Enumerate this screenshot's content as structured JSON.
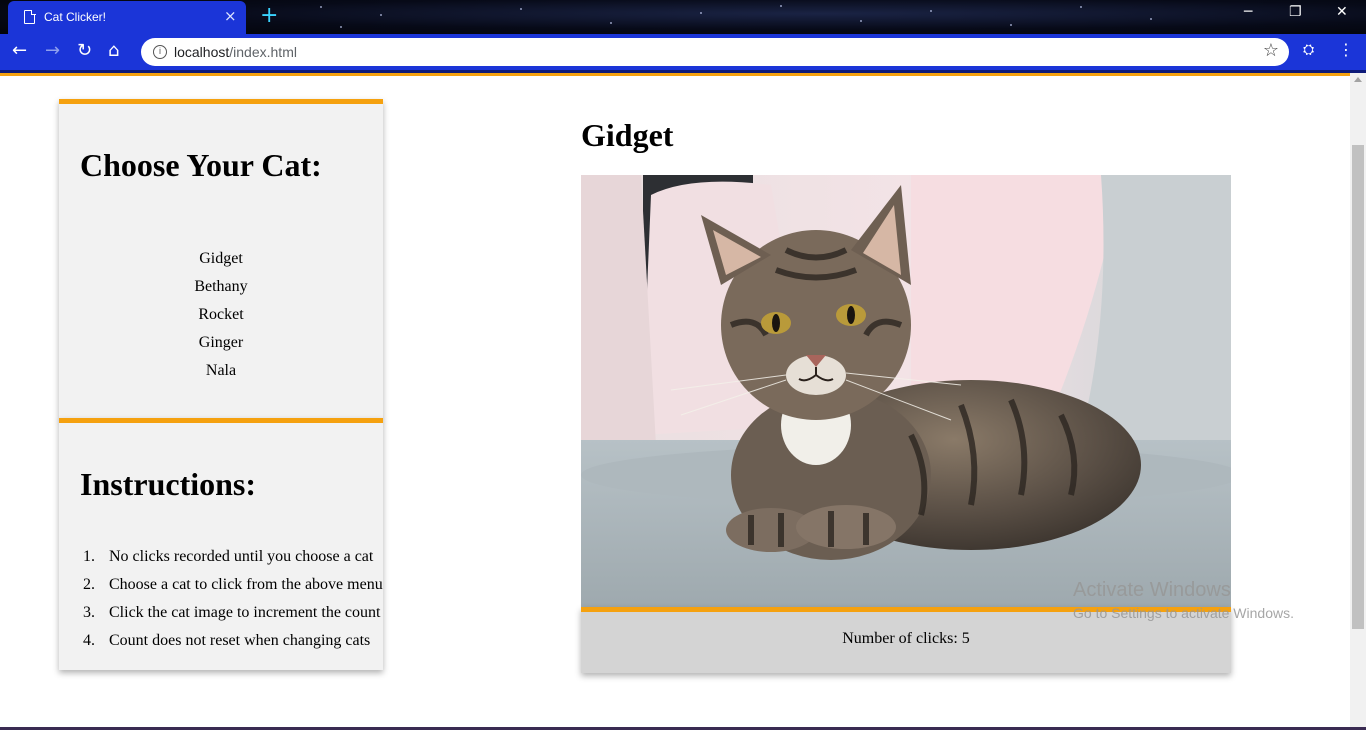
{
  "browser": {
    "tab_title": "Cat Clicker!",
    "tab_close": "×",
    "new_tab": "+",
    "url_host": "localhost",
    "url_path": "/index.html",
    "window_controls": {
      "minimize": "─",
      "restore": "❐",
      "close": "✕"
    },
    "nav": {
      "back": "←",
      "forward": "→",
      "reload": "↻",
      "home": "⌂"
    },
    "icons": {
      "info": "i",
      "star": "☆",
      "extension": "⛭",
      "menu": "⋮"
    }
  },
  "sidebar": {
    "title": "Choose Your Cat:",
    "cats": [
      "Gidget",
      "Bethany",
      "Rocket",
      "Ginger",
      "Nala"
    ]
  },
  "instructions": {
    "title": "Instructions:",
    "items": [
      {
        "num": "1.",
        "text": "No clicks recorded until you choose a cat"
      },
      {
        "num": "2.",
        "text": "Choose a cat to click from the above menu"
      },
      {
        "num": "3.",
        "text": "Click the cat image to increment the count"
      },
      {
        "num": "4.",
        "text": "Count does not reset when changing cats"
      }
    ]
  },
  "main": {
    "cat_name": "Gidget",
    "clicks_label": "Number of clicks:",
    "clicks": 5
  },
  "watermark": {
    "title": "Activate Windows",
    "subtitle": "Go to Settings to activate Windows."
  },
  "colors": {
    "accent": "#f5a10f",
    "chrome_blue": "#1b35d8",
    "panel_bg": "#f2f2f2",
    "counter_bg": "#d4d4d4"
  }
}
